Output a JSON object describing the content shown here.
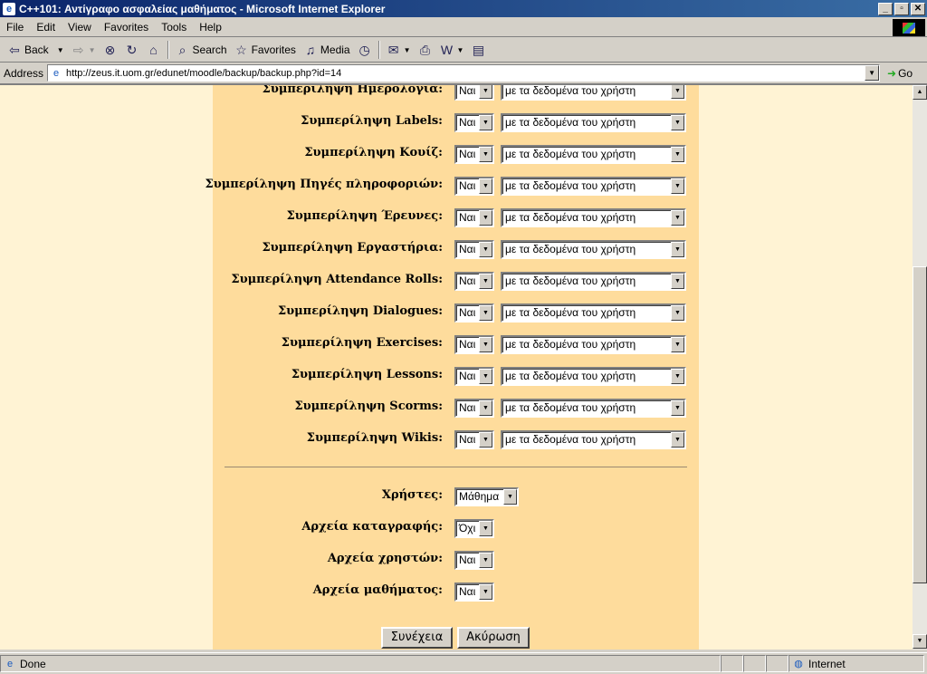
{
  "window": {
    "title": "C++101: Αντίγραφο ασφαλείας μαθήματος - Microsoft Internet Explorer",
    "min": "_",
    "max": "▫",
    "close": "✕"
  },
  "menu": [
    "File",
    "Edit",
    "View",
    "Favorites",
    "Tools",
    "Help"
  ],
  "toolbar": {
    "back": "Back",
    "search": "Search",
    "favorites": "Favorites",
    "media": "Media"
  },
  "address": {
    "label": "Address",
    "url": "http://zeus.it.uom.gr/edunet/moodle/backup/backup.php?id=14",
    "go": "Go"
  },
  "modules": [
    {
      "label": "Συμπερίληψη Ημερολόγια:",
      "include": "Ναι",
      "userdata": "με τα δεδομένα του χρήστη"
    },
    {
      "label": "Συμπερίληψη Labels:",
      "include": "Ναι",
      "userdata": "με τα δεδομένα του χρήστη"
    },
    {
      "label": "Συμπερίληψη Κουίζ:",
      "include": "Ναι",
      "userdata": "με τα δεδομένα του χρήστη"
    },
    {
      "label": "Συμπερίληψη Πηγές πληροφοριών:",
      "include": "Ναι",
      "userdata": "με τα δεδομένα του χρήστη"
    },
    {
      "label": "Συμπερίληψη Έρευνες:",
      "include": "Ναι",
      "userdata": "με τα δεδομένα του χρήστη"
    },
    {
      "label": "Συμπερίληψη Εργαστήρια:",
      "include": "Ναι",
      "userdata": "με τα δεδομένα του χρήστη"
    },
    {
      "label": "Συμπερίληψη Attendance Rolls:",
      "include": "Ναι",
      "userdata": "με τα δεδομένα του χρήστη"
    },
    {
      "label": "Συμπερίληψη Dialogues:",
      "include": "Ναι",
      "userdata": "με τα δεδομένα του χρήστη"
    },
    {
      "label": "Συμπερίληψη Exercises:",
      "include": "Ναι",
      "userdata": "με τα δεδομένα του χρήστη"
    },
    {
      "label": "Συμπερίληψη Lessons:",
      "include": "Ναι",
      "userdata": "με τα δεδομένα του χρήστη"
    },
    {
      "label": "Συμπερίληψη Scorms:",
      "include": "Ναι",
      "userdata": "με τα δεδομένα του χρήστη"
    },
    {
      "label": "Συμπερίληψη Wikis:",
      "include": "Ναι",
      "userdata": "με τα δεδομένα του χρήστη"
    }
  ],
  "options": {
    "users": {
      "label": "Χρήστες:",
      "value": "Μάθημα"
    },
    "logs": {
      "label": "Αρχεία καταγραφής:",
      "value": "Όχι"
    },
    "userfiles": {
      "label": "Αρχεία χρηστών:",
      "value": "Ναι"
    },
    "coursefiles": {
      "label": "Αρχεία μαθήματος:",
      "value": "Ναι"
    }
  },
  "buttons": {
    "continue": "Συνέχεια",
    "cancel": "Ακύρωση"
  },
  "status": {
    "text": "Done",
    "zone": "Internet"
  }
}
